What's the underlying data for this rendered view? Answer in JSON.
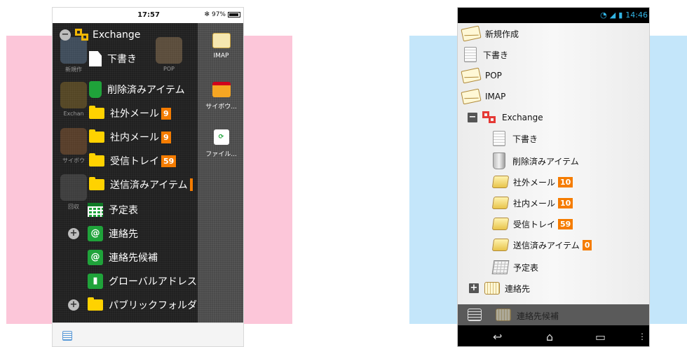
{
  "ios": {
    "status": {
      "time": "17:57",
      "battery": "97%"
    },
    "background_apps": [
      {
        "label": "新規作"
      },
      {
        "label": "POP"
      },
      {
        "label": "Exchan"
      },
      {
        "label": "サイボウ"
      },
      {
        "label": "回収"
      }
    ],
    "right_column": [
      {
        "label": "IMAP",
        "icon": "mail-icon"
      },
      {
        "label": "サイボウ...",
        "icon": "calendar-icon"
      },
      {
        "label": "ファイル...",
        "icon": "sync-icon"
      }
    ],
    "drawer": {
      "exchange": {
        "label": "Exchange",
        "toggle": "−"
      },
      "items": [
        {
          "label": "下書き",
          "icon": "draft-icon"
        },
        {
          "label": "削除済みアイテム",
          "icon": "trash-icon"
        },
        {
          "label": "社外メール",
          "icon": "folder-icon",
          "badge": "9"
        },
        {
          "label": "社内メール",
          "icon": "folder-icon",
          "badge": "9"
        },
        {
          "label": "受信トレイ",
          "icon": "folder-icon",
          "badge": "59"
        },
        {
          "label": "送信済みアイテム",
          "icon": "folder-icon"
        },
        {
          "label": "予定表",
          "icon": "calendar-icon"
        },
        {
          "label": "連絡先",
          "icon": "contacts-icon",
          "toggle": "+"
        },
        {
          "label": "連絡先候補",
          "icon": "contacts-icon"
        },
        {
          "label": "グローバルアドレス",
          "icon": "address-book-icon"
        },
        {
          "label": "パブリックフォルダ",
          "icon": "folder-icon",
          "toggle": "+"
        }
      ]
    }
  },
  "android": {
    "status": {
      "time": "14:46"
    },
    "items": [
      {
        "label": "新規作成",
        "icon": "compose-icon"
      },
      {
        "label": "下書き",
        "icon": "draft-icon"
      },
      {
        "label": "POP",
        "icon": "envelope-icon"
      },
      {
        "label": "IMAP",
        "icon": "envelope-icon"
      },
      {
        "label": "Exchange",
        "icon": "exchange-icon",
        "toggle": "−"
      },
      {
        "label": "下書き",
        "icon": "draft-icon"
      },
      {
        "label": "削除済みアイテム",
        "icon": "trash-icon"
      },
      {
        "label": "社外メール",
        "icon": "folder-icon",
        "badge": "10"
      },
      {
        "label": "社内メール",
        "icon": "folder-icon",
        "badge": "10"
      },
      {
        "label": "受信トレイ",
        "icon": "folder-icon",
        "badge": "59"
      },
      {
        "label": "送信済みアイテム",
        "icon": "folder-icon",
        "badge": "0"
      },
      {
        "label": "予定表",
        "icon": "calendar-icon"
      },
      {
        "label": "連絡先",
        "icon": "contacts-icon",
        "toggle": "+"
      }
    ],
    "overlay_item": {
      "label": "連絡先候補"
    },
    "nav": {
      "back": "back-icon",
      "home": "home-icon",
      "recents": "recents-icon"
    }
  },
  "colors": {
    "badge": "#f57c00",
    "ios_green": "#1fa33a",
    "exchange_ios": "#f2b705",
    "exchange_android": "#e53935",
    "android_status_accent": "#33b5e5"
  }
}
